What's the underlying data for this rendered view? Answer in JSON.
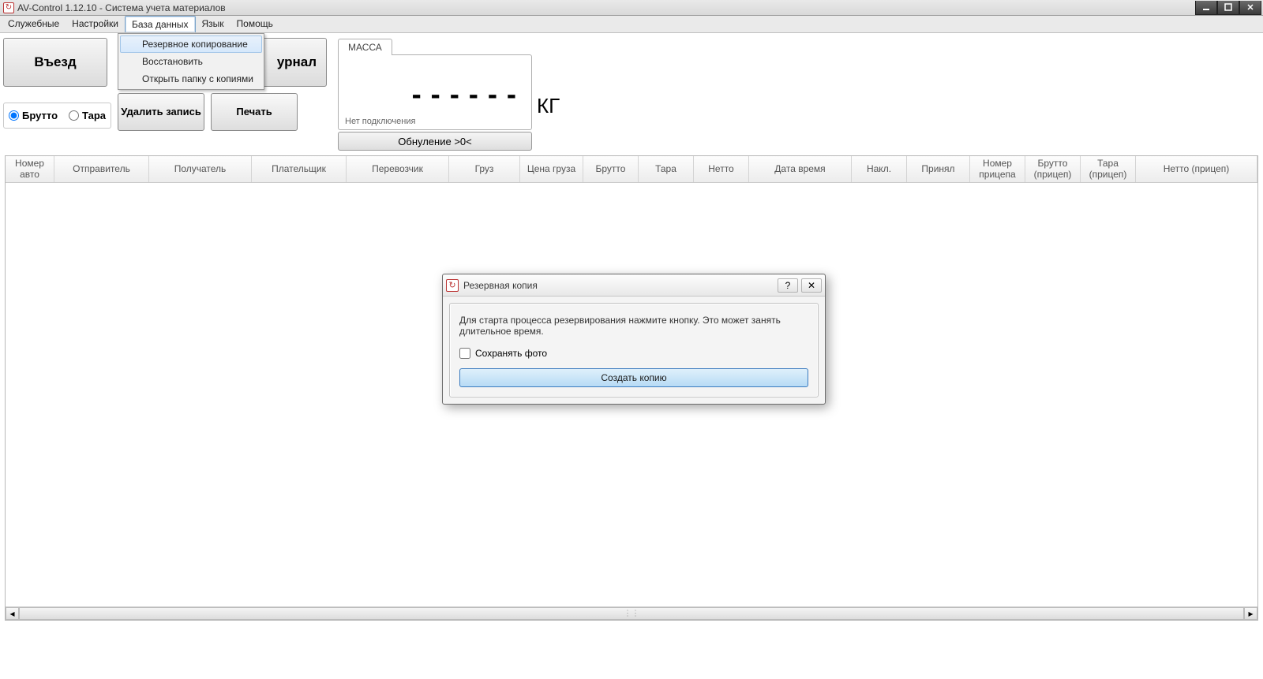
{
  "window": {
    "title": "AV-Control 1.12.10 - Система учета материалов"
  },
  "menu": {
    "items": [
      "Служебные",
      "Настройки",
      "База данных",
      "Язык",
      "Помощь"
    ],
    "active_index": 2,
    "dropdown": [
      "Резервное копирование",
      "Восстановить",
      "Открыть папку с копиями"
    ],
    "dropdown_highlight_index": 0
  },
  "toolbar": {
    "entry": "Въезд",
    "journal": "урнал",
    "radio_brutto": "Брутто",
    "radio_tara": "Тара",
    "delete_rec": "Удалить запись",
    "print": "Печать"
  },
  "mass": {
    "tab": "МАССА",
    "digits": "------",
    "status": "Нет подключения",
    "unit": "КГ",
    "zero": "Обнуление >0<"
  },
  "table": {
    "headers": [
      "Номер авто",
      "Отправитель",
      "Получатель",
      "Плательщик",
      "Перевозчик",
      "Груз",
      "Цена груза",
      "Брутто",
      "Тара",
      "Нетто",
      "Дата время",
      "Накл.",
      "Принял",
      "Номер прицепа",
      "Брутто (прицеп)",
      "Тара (прицеп)",
      "Нетто (прицеп)"
    ]
  },
  "dialog": {
    "title": "Резервная копия",
    "message": "Для старта процесса резервирования нажмите кнопку. Это может занять длительное время.",
    "checkbox": "Сохранять фото",
    "action": "Создать копию"
  }
}
